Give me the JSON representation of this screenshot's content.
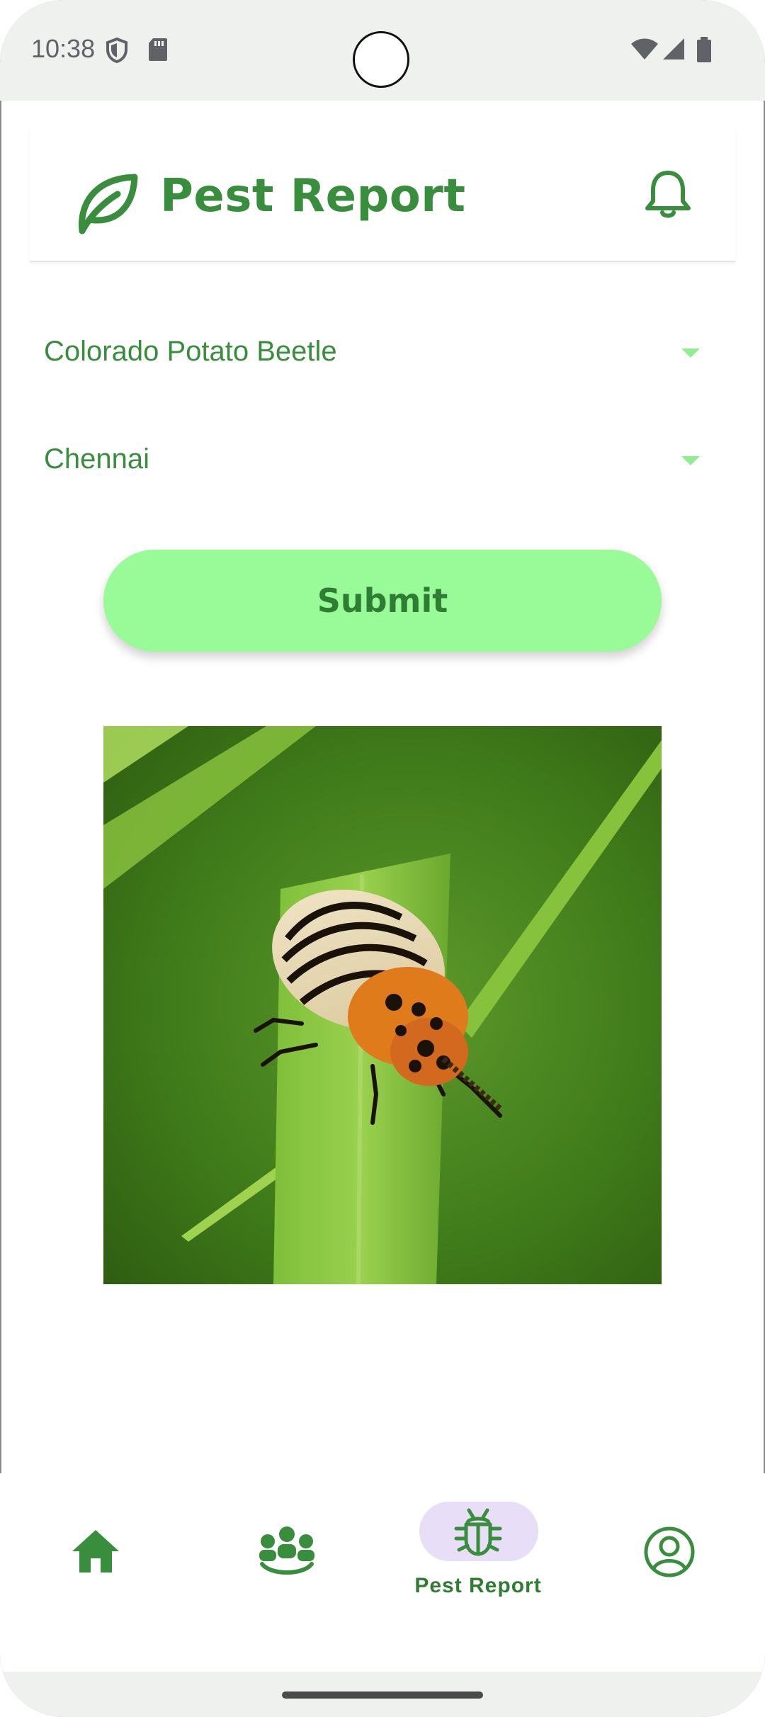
{
  "status_bar": {
    "time": "10:38",
    "icons": [
      "shield-icon",
      "sd-card-icon",
      "wifi-icon",
      "signal-icon",
      "battery-icon"
    ]
  },
  "header": {
    "title": "Pest Report",
    "logo_icon": "leaf-icon",
    "notification_icon": "bell-icon"
  },
  "form": {
    "pest_select": {
      "value": "Colorado Potato Beetle"
    },
    "location_select": {
      "value": "Chennai"
    },
    "submit_label": "Submit"
  },
  "image": {
    "subject_icon": "beetle-photo"
  },
  "bottom_nav": {
    "items": [
      {
        "icon": "home-icon",
        "label": "",
        "active": false
      },
      {
        "icon": "community-icon",
        "label": "",
        "active": false
      },
      {
        "icon": "bug-icon",
        "label": "Pest Report",
        "active": true
      },
      {
        "icon": "account-circle-icon",
        "label": "",
        "active": false
      }
    ]
  },
  "colors": {
    "primary": "#388e3c",
    "accent": "#98fb98",
    "active_pill": "#e8def8",
    "status_bar": "#eef1ee"
  }
}
